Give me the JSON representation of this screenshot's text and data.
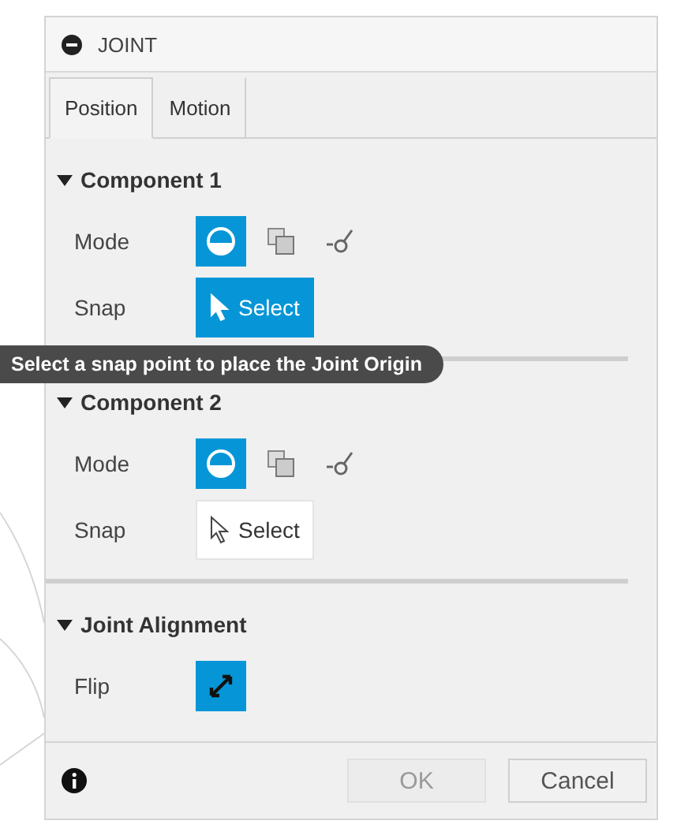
{
  "panel": {
    "title": "JOINT"
  },
  "tabs": [
    {
      "label": "Position",
      "selected": true
    },
    {
      "label": "Motion",
      "selected": false
    }
  ],
  "sections": [
    {
      "title": "Component 1",
      "expanded": true,
      "rows": [
        {
          "kind": "mode",
          "label": "Mode",
          "options": [
            {
              "selected": true
            },
            {
              "selected": false
            },
            {
              "selected": false
            }
          ]
        },
        {
          "kind": "snap",
          "label": "Snap",
          "button": "Select",
          "active": true
        }
      ]
    },
    {
      "title": "Component 2",
      "expanded": true,
      "rows": [
        {
          "kind": "mode",
          "label": "Mode",
          "options": [
            {
              "selected": true
            },
            {
              "selected": false
            },
            {
              "selected": false
            }
          ]
        },
        {
          "kind": "snap",
          "label": "Snap",
          "button": "Select",
          "active": false
        }
      ]
    },
    {
      "title": "Joint Alignment",
      "expanded": true,
      "rows": [
        {
          "kind": "flip",
          "label": "Flip",
          "on": true
        }
      ]
    }
  ],
  "tooltip": "Select a snap point to place the Joint Origin",
  "footer": {
    "buttons": [
      {
        "label": "OK",
        "disabled": true
      },
      {
        "label": "Cancel",
        "disabled": false
      }
    ]
  }
}
